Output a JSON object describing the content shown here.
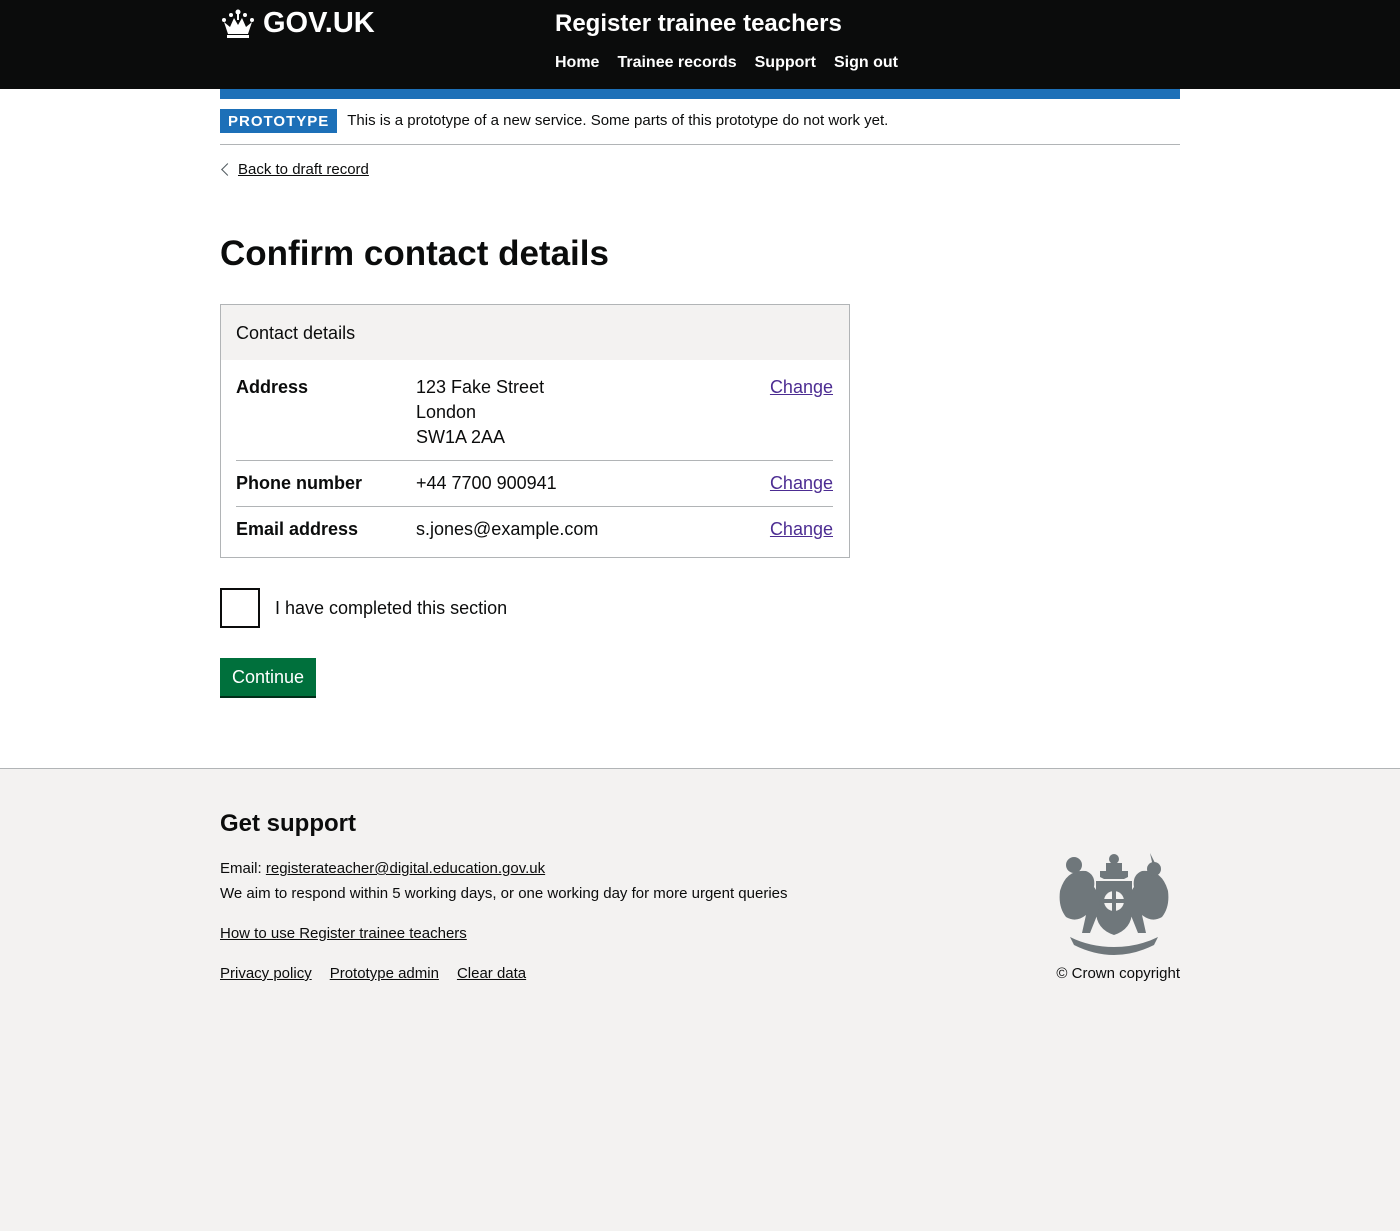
{
  "header": {
    "logo_text": "GOV.UK",
    "service_name": "Register trainee teachers",
    "nav": [
      "Home",
      "Trainee records",
      "Support",
      "Sign out"
    ]
  },
  "phase_banner": {
    "tag": "PROTOTYPE",
    "text": "This is a prototype of a new service. Some parts of this prototype do not work yet."
  },
  "back_link": "Back to draft record",
  "page_title": "Confirm contact details",
  "summary_card": {
    "title": "Contact details",
    "rows": [
      {
        "key": "Address",
        "value_lines": [
          "123 Fake Street",
          "London",
          "SW1A 2AA"
        ],
        "action": "Change"
      },
      {
        "key": "Phone number",
        "value": "+44 7700 900941",
        "action": "Change"
      },
      {
        "key": "Email address",
        "value": "s.jones@example.com",
        "action": "Change"
      }
    ]
  },
  "completed_checkbox": {
    "label": "I have completed this section",
    "checked": false
  },
  "continue_button": "Continue",
  "footer": {
    "heading": "Get support",
    "email_label": "Email:",
    "email": "registerateacher@digital.education.gov.uk",
    "response_note": "We aim to respond within 5 working days, or one working day for more urgent queries",
    "how_to_link": "How to use Register trainee teachers",
    "links": [
      "Privacy policy",
      "Prototype admin",
      "Clear data"
    ],
    "copyright": "© Crown copyright"
  },
  "colors": {
    "header_bg": "#0b0c0c",
    "brand_blue": "#1d70b8",
    "button_green": "#00703c",
    "link_visited": "#4c2c92",
    "footer_bg": "#f3f2f1"
  },
  "icons": [
    "crown-icon",
    "chevron-left-icon",
    "royal-coat-of-arms-icon"
  ]
}
